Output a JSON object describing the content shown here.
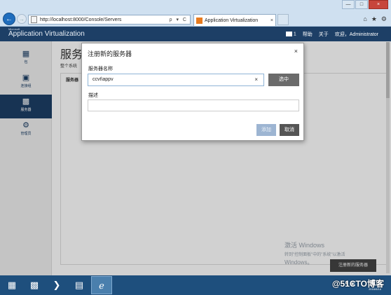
{
  "browser": {
    "url": "http://localhost:8000/Console/Servers",
    "tab_title": "Application Virtualization",
    "tab_close": "×",
    "url_tools": "ρ ▾ C",
    "win_min": "—",
    "win_max": "□",
    "win_close": "×"
  },
  "header": {
    "brand_small": "Microsoft",
    "brand": "Application Virtualization",
    "msg_count": "1",
    "help": "帮助",
    "about": "关于",
    "welcome": "欢迎，Administrator"
  },
  "sidebar": {
    "items": [
      {
        "label": "包",
        "icon": "packages-icon"
      },
      {
        "label": "连接组",
        "icon": "connection-groups-icon"
      },
      {
        "label": "服务器",
        "icon": "servers-icon"
      },
      {
        "label": "管理员",
        "icon": "admin-gear-icon"
      }
    ]
  },
  "page": {
    "title": "服务",
    "subtitle": "整个系统",
    "panel_label": "服务器",
    "register_button": "注册新的服务器"
  },
  "dialog": {
    "title": "注册新的服务器",
    "close": "×",
    "server_name_label": "服务器名称",
    "server_name_value": "ccvt\\appv",
    "clear": "×",
    "select_button": "选中",
    "description_label": "描述",
    "description_value": "",
    "add_button": "添加",
    "cancel_button": "取消"
  },
  "activation": {
    "line1": "激活 Windows",
    "line2": "转到\"控制面板\"中的\"系统\"以激活",
    "line3": "Windows。"
  },
  "watermark": {
    "text": "@51CTO博客",
    "date": "2016/6/16"
  }
}
